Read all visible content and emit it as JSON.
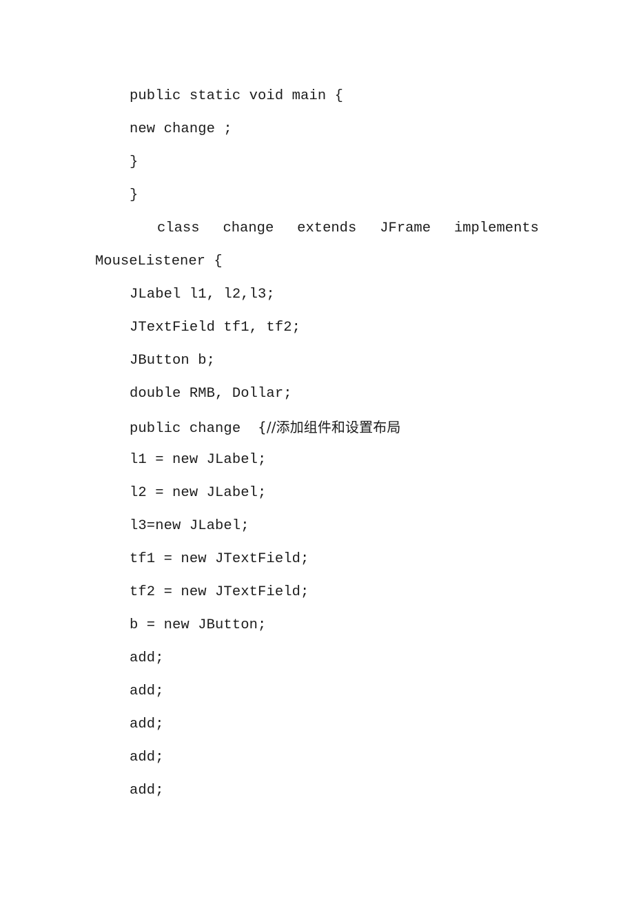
{
  "document": {
    "page_background": "#ffffff",
    "text_color": "#1c1c1c",
    "language_note": "java-source-code",
    "lines": [
      {
        "id": "line-1",
        "text": "public static void main {"
      },
      {
        "id": "line-2",
        "text": "new change ;"
      },
      {
        "id": "line-3",
        "text": "}"
      },
      {
        "id": "line-4",
        "text": "}"
      },
      {
        "id": "line-6",
        "text": "JLabel l1, l2,l3;"
      },
      {
        "id": "line-7",
        "text": "JTextField tf1, tf2;"
      },
      {
        "id": "line-8",
        "text": "JButton b;"
      },
      {
        "id": "line-9",
        "text": "double RMB, Dollar;"
      },
      {
        "id": "line-11",
        "text": "l1 = new JLabel;"
      },
      {
        "id": "line-12",
        "text": "l2 = new JLabel;"
      },
      {
        "id": "line-13",
        "text": "l3=new JLabel;"
      },
      {
        "id": "line-14",
        "text": "tf1 = new JTextField;"
      },
      {
        "id": "line-15",
        "text": "tf2 = new JTextField;"
      },
      {
        "id": "line-16",
        "text": "b = new JButton;"
      },
      {
        "id": "line-17",
        "text": "add;"
      },
      {
        "id": "line-18",
        "text": "add;"
      },
      {
        "id": "line-19",
        "text": "add;"
      },
      {
        "id": "line-20",
        "text": "add;"
      },
      {
        "id": "line-21",
        "text": "add;"
      }
    ],
    "class_declaration": {
      "id": "line-5",
      "full_text": "class change extends JFrame implements MouseListener {",
      "first_row_words": [
        "class",
        "change",
        "extends",
        "JFrame",
        "implements"
      ],
      "second_row_text": "MouseListener {"
    },
    "constructor_line": {
      "id": "line-10",
      "code": "public change  ",
      "comment": "{//添加组件和设置布局",
      "full_text": "public change  {//添加组件和设置布局"
    }
  }
}
